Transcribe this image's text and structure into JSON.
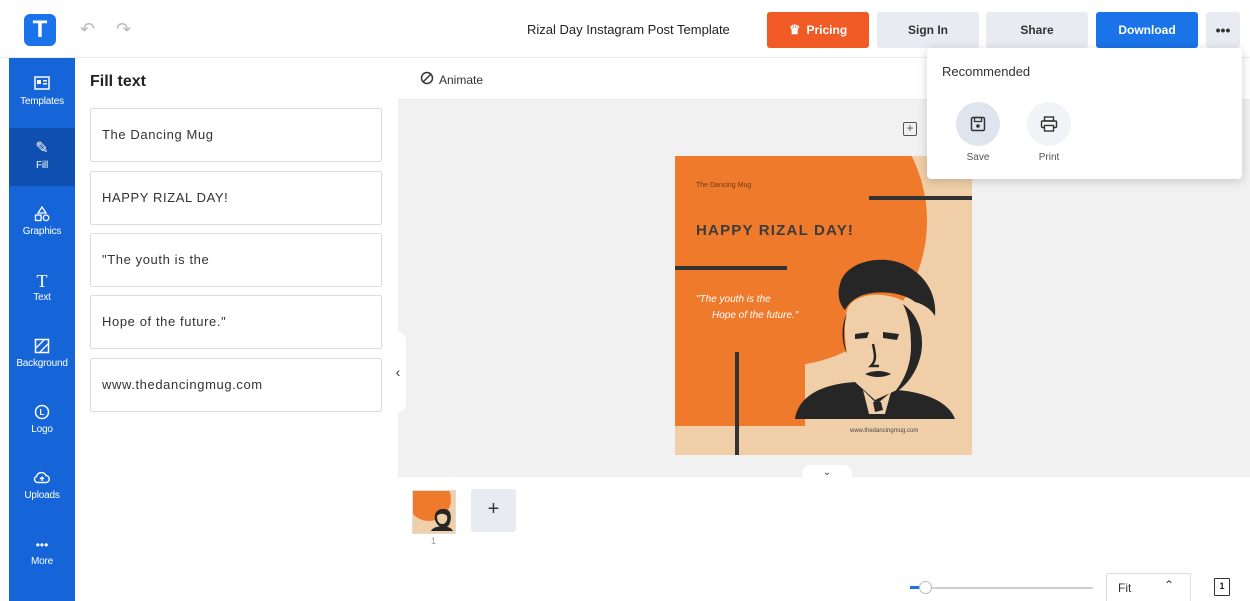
{
  "app": {
    "logo_letter": "T",
    "doc_title": "Rizal Day Instagram Post Template"
  },
  "toolbar": {
    "pricing_label": "Pricing",
    "signin_label": "Sign In",
    "share_label": "Share",
    "download_label": "Download",
    "more_label": "•••"
  },
  "sidebar": {
    "items": [
      {
        "label": "Templates",
        "icon": "templates-icon"
      },
      {
        "label": "Fill",
        "icon": "pencil-icon"
      },
      {
        "label": "Graphics",
        "icon": "shapes-icon"
      },
      {
        "label": "Text",
        "icon": "text-icon"
      },
      {
        "label": "Background",
        "icon": "background-icon"
      },
      {
        "label": "Logo",
        "icon": "logo-icon"
      },
      {
        "label": "Uploads",
        "icon": "upload-cloud-icon"
      },
      {
        "label": "More",
        "icon": "more-dots-icon"
      }
    ]
  },
  "panel": {
    "title": "Fill text",
    "fields": [
      "The Dancing Mug",
      "HAPPY RIZAL DAY!",
      "\"The youth is the",
      "Hope of the future.\"",
      "www.thedancingmug.com"
    ]
  },
  "work": {
    "animate_label": "Animate"
  },
  "design": {
    "brand": "The Dancing Mug",
    "heading": "HAPPY RIZAL DAY!",
    "quote_line1": "\"The youth is the",
    "quote_line2": "Hope of the future.\"",
    "url": "www.thedancingmug.com",
    "colors": {
      "orange": "#f07a2c",
      "beige": "#f0cfa8",
      "dark": "#333333"
    }
  },
  "pages": {
    "current": "1"
  },
  "zoom": {
    "mode": "Fit"
  },
  "dropdown": {
    "heading": "Recommended",
    "items": [
      {
        "label": "Save",
        "icon": "save-icon"
      },
      {
        "label": "Print",
        "icon": "printer-icon"
      }
    ]
  }
}
